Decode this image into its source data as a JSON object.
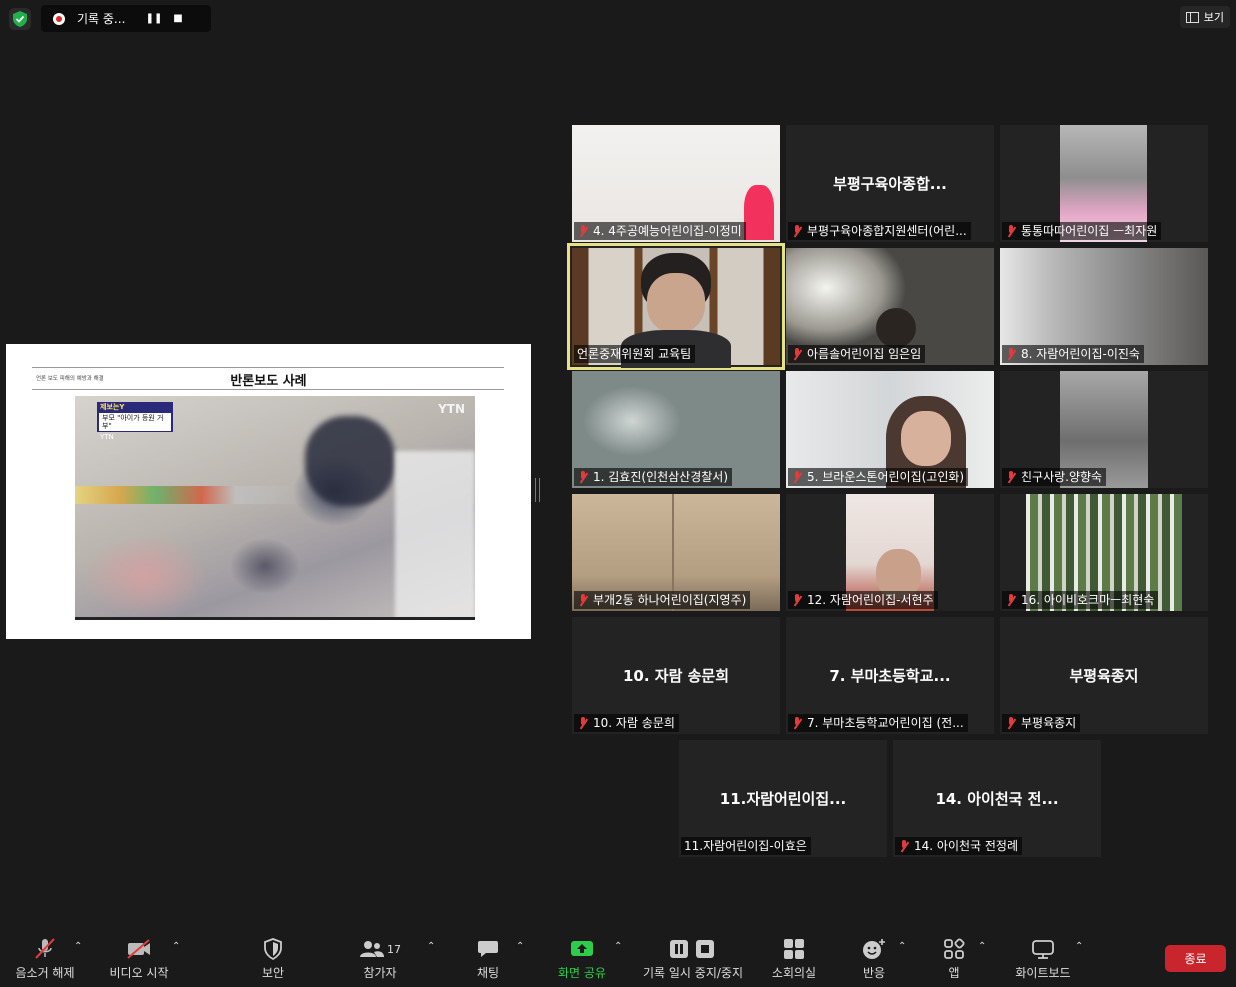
{
  "top": {
    "recording_text": "기록 중...",
    "view_label": "보기"
  },
  "slide": {
    "subtitle": "언론 보도 피해의 예방과 해결",
    "title": "반론보도 사례",
    "video_logo": "YTN",
    "badge_line1": "제보는Y",
    "badge_line2": "부모 \"아이가 등원 거부\"",
    "badge_line3": "YTN"
  },
  "participants": [
    {
      "label": "4. 4주공예능어린이집-이정미",
      "muted": true
    },
    {
      "label": "부평구육아종합지원센터(어린...",
      "big_name": "부평구육아종합...",
      "muted": true
    },
    {
      "label": "통통따따어린이집 ㅡ최자원",
      "muted": true
    },
    {
      "label": "언론중재위원회 교육팀",
      "muted": false,
      "active": true
    },
    {
      "label": "아름솔어린이집 임은임",
      "muted": true
    },
    {
      "label": "8. 자람어린이집-이진숙",
      "muted": true
    },
    {
      "label": "1. 김효진(인천삼산경찰서)",
      "muted": true
    },
    {
      "label": "5. 브라운스톤어린이집(고인화)",
      "muted": true
    },
    {
      "label": "친구사랑.양향숙",
      "muted": true
    },
    {
      "label": "부개2동 하나어린이집(지영주)",
      "muted": true
    },
    {
      "label": "12. 자람어린이집-서현주",
      "muted": true
    },
    {
      "label": "16. 아이비호크마ㅡ최현숙",
      "muted": true
    },
    {
      "label": "10. 자람 송문희",
      "big_name": "10. 자람 송문희",
      "muted": true
    },
    {
      "label": "7. 부마초등학교어린이집 (전...",
      "big_name": "7. 부마초등학교...",
      "muted": true
    },
    {
      "label": "부평육종지",
      "big_name": "부평육종지",
      "muted": true
    },
    {
      "label": "11.자람어린이집-이효은",
      "big_name": "11.자람어린이집...",
      "muted": false
    },
    {
      "label": "14. 아이천국 전정례",
      "big_name": "14. 아이천국 전...",
      "muted": true
    }
  ],
  "toolbar": {
    "unmute": "음소거 해제",
    "start_video": "비디오 시작",
    "security": "보안",
    "participants": "참가자",
    "participants_count": "17",
    "chat": "채팅",
    "share_screen": "화면 공유",
    "pause_recording": "기록 일시 중지/중지",
    "breakout": "소회의실",
    "reactions": "반응",
    "apps": "앱",
    "whiteboard": "화이트보드",
    "end": "종료"
  },
  "colors": {
    "active_speaker": "#e6e283",
    "end_button": "#c9252c",
    "share_green": "#2ecc4a",
    "muted_red": "#e23b3b"
  }
}
